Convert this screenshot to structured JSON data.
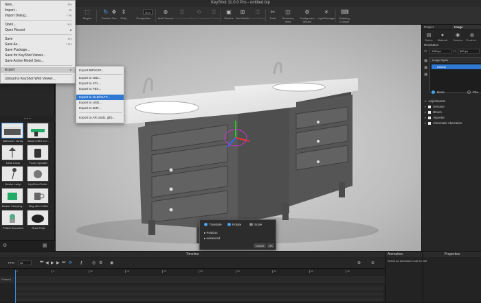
{
  "window": {
    "title": "KeyShot 11.0.0 Pro - untitled.bip"
  },
  "toolbar": {
    "items": [
      {
        "label": "Region",
        "icon": "region-icon"
      },
      {
        "label": "Tumble",
        "icon": "tumble-icon"
      },
      {
        "label": "Pan",
        "icon": "pan-icon"
      },
      {
        "label": "Dolly",
        "icon": "dolly-icon"
      },
      {
        "label": "Perspective",
        "icon": "perspective-icon"
      },
      {
        "label": "Add Camera",
        "icon": "add-camera-icon"
      },
      {
        "label": "Lock Camera",
        "icon": "lock-camera-icon"
      },
      {
        "label": "Reset Camera",
        "icon": "reset-camera-icon"
      },
      {
        "label": "Lock Camera",
        "icon": "lock-camera2-icon"
      },
      {
        "label": "Studios",
        "icon": "studios-icon"
      },
      {
        "label": "Add Studio",
        "icon": "add-studio-icon"
      },
      {
        "label": "Lock Studios",
        "icon": "lock-studios-icon"
      },
      {
        "label": "Tools",
        "icon": "tools-icon"
      },
      {
        "label": "Geometry View",
        "icon": "geometry-view-icon"
      },
      {
        "label": "Configurator Wizard",
        "icon": "configurator-icon"
      },
      {
        "label": "Light Manager",
        "icon": "light-manager-icon"
      },
      {
        "label": "Scripting Console",
        "icon": "scripting-icon"
      }
    ],
    "perspective_value": "50.0"
  },
  "file_menu": {
    "items": [
      {
        "label": "New...",
        "shortcut": "⌘N"
      },
      {
        "label": "Import...",
        "shortcut": "⌘I"
      },
      {
        "label": "Import Dialog...",
        "shortcut": "⇧⌘I"
      },
      {
        "label": "Open...",
        "shortcut": "⌘O"
      },
      {
        "label": "Open Recent",
        "shortcut": "▶"
      },
      {
        "label": "Save",
        "shortcut": "⌘S"
      },
      {
        "label": "Save As...",
        "shortcut": "⇧⌘S"
      },
      {
        "label": "Save Package...",
        "shortcut": ""
      },
      {
        "label": "Save for KeyShot Viewer...",
        "shortcut": ""
      },
      {
        "label": "Save Active Model Sets...",
        "shortcut": ""
      },
      {
        "label": "Export",
        "shortcut": "▶"
      },
      {
        "label": "Upload to KeyShot Web Viewer...",
        "shortcut": ""
      }
    ]
  },
  "export_submenu": {
    "items": [
      "Export BIP/KSP...",
      "Export to OBJ...",
      "Export to STL...",
      "Export to FBX...",
      "Export to GLB/GLTF...",
      "Export to USD...",
      "Export to 3MF...",
      "Export to AR (usdz, glb)..."
    ],
    "highlighted_index": 4
  },
  "library": {
    "thumbs": [
      {
        "label": "Bathroom Vanity"
      },
      {
        "label": "Bosch GBH 2-2..."
      },
      {
        "label": "Desk Lamp"
      },
      {
        "label": "Fuzzy Speaker"
      },
      {
        "label": "Hector Lamp"
      },
      {
        "label": "KeyShot Christ..."
      },
      {
        "label": "Master Camping..."
      },
      {
        "label": "Mug with Coffee"
      },
      {
        "label": "Potted Succulent"
      },
      {
        "label": "Rock Pack"
      }
    ]
  },
  "right_panel": {
    "tabs": [
      "Project",
      "Image"
    ],
    "subtabs": [
      {
        "label": "Scene",
        "icon": "scene-icon"
      },
      {
        "label": "Material",
        "icon": "material-icon"
      },
      {
        "label": "Camera",
        "icon": "camera-icon"
      },
      {
        "label": "Environ...",
        "icon": "environment-icon"
      }
    ],
    "resolution_label": "Resolution",
    "res_w": "1364 px",
    "res_h": "860 px",
    "image_styles_label": "Image Styles",
    "default_style": "Default",
    "mode_basic": "Basic",
    "mode_photo": "Pho",
    "adjustments_label": "Adjustments",
    "adjustments": [
      "Denoise",
      "Bloom",
      "Vignette",
      "Chromatic Aberration"
    ]
  },
  "transform_popup": {
    "tabs": [
      "Translate",
      "Rotate",
      "Scale"
    ],
    "rows": [
      "Position",
      "Advanced"
    ],
    "cancel": "Cancel",
    "ok": "OK"
  },
  "timeline": {
    "title": "Timeline",
    "fps_label": "FPS",
    "fps_value": "30",
    "track_label": "Frame 1",
    "ticks": [
      "0",
      "5",
      "10",
      "15",
      "20",
      "25",
      "30",
      "35",
      "40",
      "45"
    ]
  },
  "animation": {
    "title": "Animation"
  },
  "properties": {
    "title": "Properties",
    "hint": "Select an animation node to edit"
  }
}
